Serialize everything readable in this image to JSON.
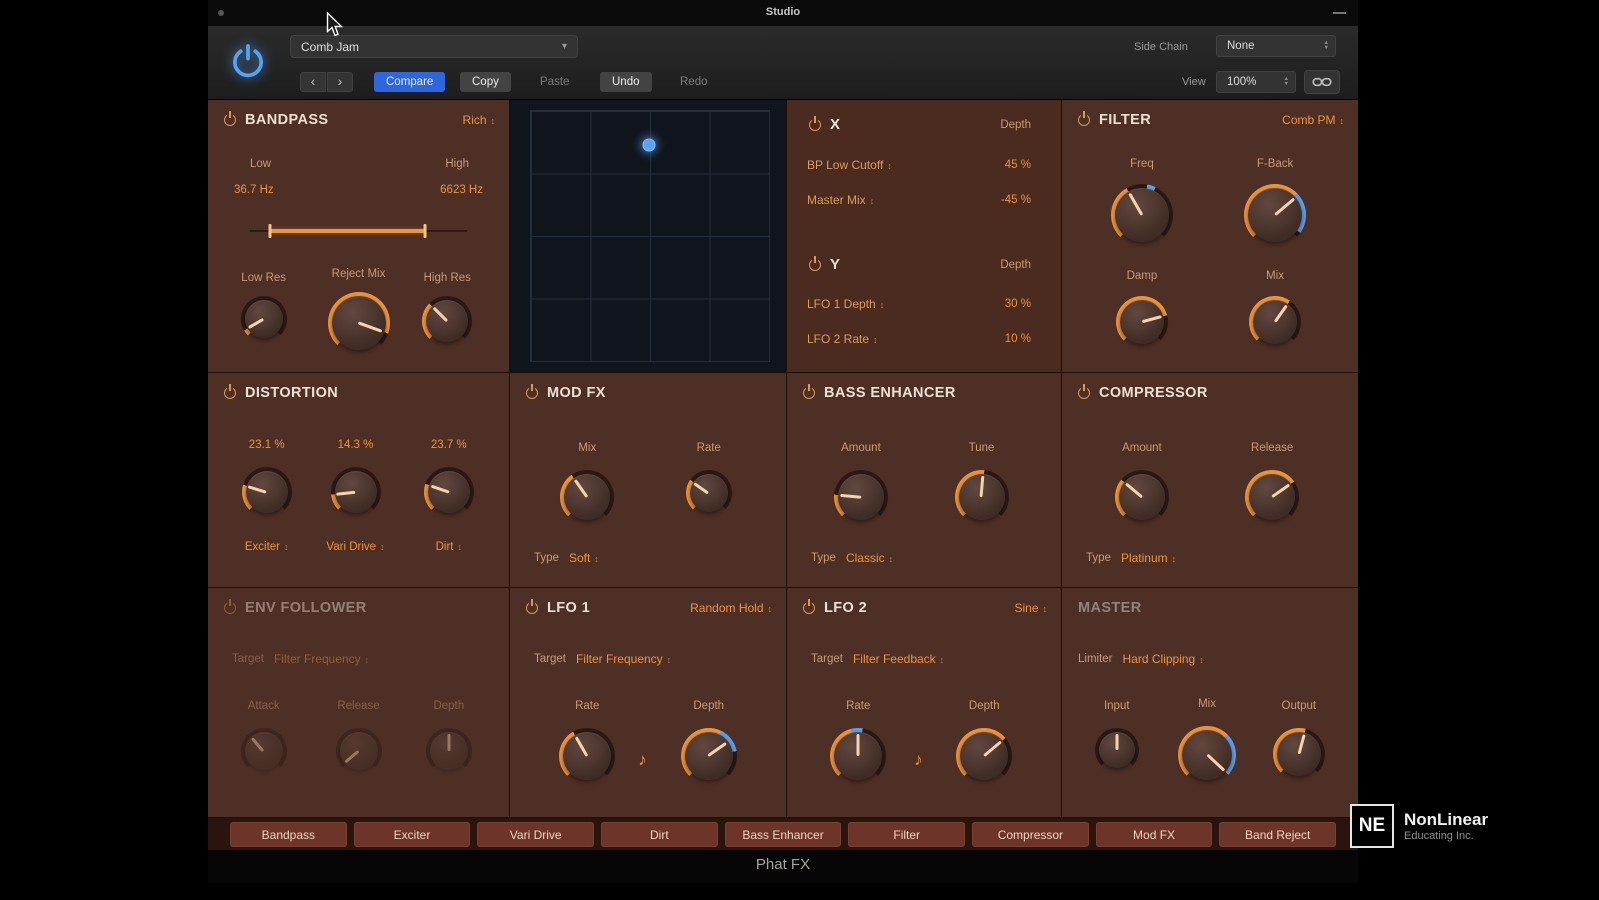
{
  "icons": {
    "note": "♪",
    "chevron": "▾",
    "nav_back": "‹",
    "nav_fwd": "›"
  },
  "titlebar": {
    "title": "Studio"
  },
  "toolbar": {
    "preset": "Comb Jam",
    "compare": "Compare",
    "copy": "Copy",
    "paste": "Paste",
    "undo": "Undo",
    "redo": "Redo",
    "side_chain_label": "Side Chain",
    "side_chain_value": "None",
    "view_label": "View",
    "view_value": "100%"
  },
  "colors": {
    "accent_orange": "#ef943c",
    "accent_blue": "#58a0f2",
    "compare_blue": "#2e66e0",
    "panel": "#4e2f26"
  },
  "bandpass": {
    "title": "BANDPASS",
    "mode": "Rich",
    "low_label": "Low",
    "high_label": "High",
    "low_value": "36.7 Hz",
    "high_value": "6623 Hz",
    "knob1_label": "Low Res",
    "knob2_label": "Reject Mix",
    "knob3_label": "High Res"
  },
  "xymod": {
    "x_title": "X",
    "y_title": "Y",
    "depth_label": "Depth",
    "x1_param": "BP Low Cutoff",
    "x1_value": "45 %",
    "x2_param": "Master Mix",
    "x2_value": "-45 %",
    "y1_param": "LFO 1 Depth",
    "y1_value": "30 %",
    "y2_param": "LFO 2 Rate",
    "y2_value": "10 %"
  },
  "filter": {
    "title": "FILTER",
    "mode": "Comb PM",
    "freq_label": "Freq",
    "fback_label": "F-Back",
    "damp_label": "Damp",
    "mix_label": "Mix"
  },
  "distortion": {
    "title": "DISTORTION",
    "v1": "23.1 %",
    "v2": "14.3 %",
    "v3": "23.7 %",
    "t1": "Exciter",
    "t2": "Vari Drive",
    "t3": "Dirt"
  },
  "modfx": {
    "title": "MOD FX",
    "mix_label": "Mix",
    "rate_label": "Rate",
    "type_label": "Type",
    "type_value": "Soft"
  },
  "bass": {
    "title": "BASS ENHANCER",
    "amount_label": "Amount",
    "tune_label": "Tune",
    "type_label": "Type",
    "type_value": "Classic"
  },
  "compressor": {
    "title": "COMPRESSOR",
    "amount_label": "Amount",
    "release_label": "Release",
    "type_label": "Type",
    "type_value": "Platinum"
  },
  "env": {
    "title": "ENV FOLLOWER",
    "target_label": "Target",
    "target_value": "Filter Frequency",
    "k1": "Attack",
    "k2": "Release",
    "k3": "Depth"
  },
  "lfo1": {
    "title": "LFO 1",
    "mode": "Random Hold",
    "target_label": "Target",
    "target_value": "Filter Frequency",
    "rate_label": "Rate",
    "depth_label": "Depth"
  },
  "lfo2": {
    "title": "LFO 2",
    "mode": "Sine",
    "target_label": "Target",
    "target_value": "Filter Feedback",
    "rate_label": "Rate",
    "depth_label": "Depth"
  },
  "master": {
    "title": "MASTER",
    "limiter_label": "Limiter",
    "limiter_value": "Hard Clipping",
    "k1": "Input",
    "k2": "Mix",
    "k3": "Output"
  },
  "chips": [
    "Bandpass",
    "Exciter",
    "Vari Drive",
    "Dirt",
    "Bass Enhancer",
    "Filter",
    "Compressor",
    "Mod FX",
    "Band Reject"
  ],
  "footer": {
    "plugin_name": "Phat FX"
  },
  "branding": {
    "logo": "NE",
    "name": "NonLinear",
    "sub": "Educating Inc."
  }
}
